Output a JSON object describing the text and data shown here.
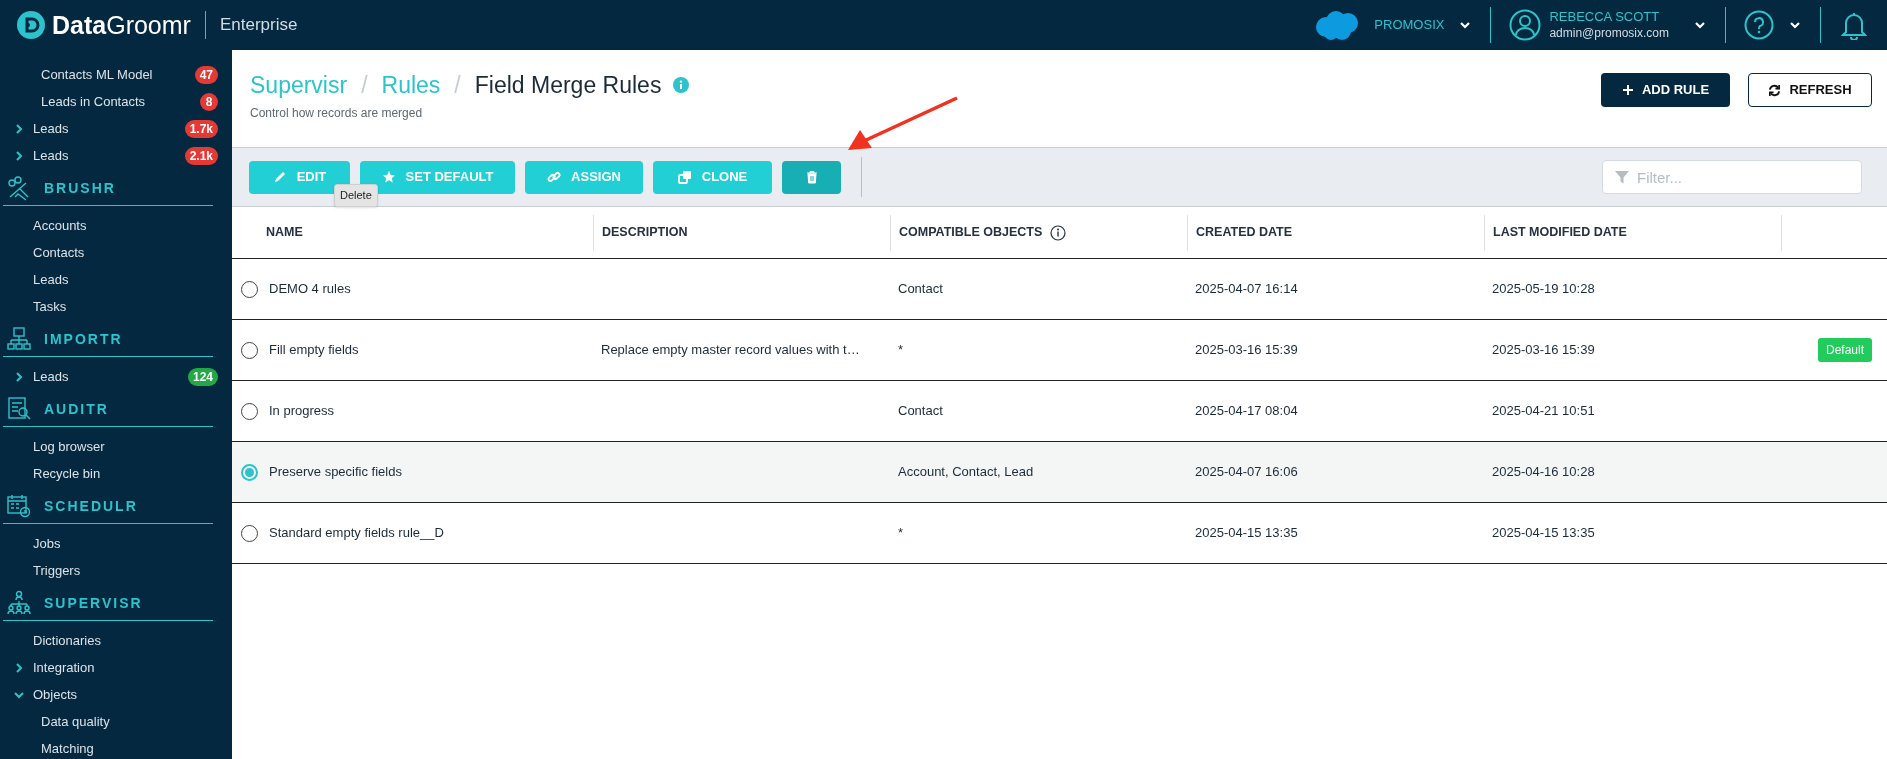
{
  "app": {
    "logo_bold": "Data",
    "logo_light": "Groomr",
    "edition": "Enterprise"
  },
  "org": {
    "name": "PROMOSIX"
  },
  "user": {
    "name": "REBECCA SCOTT",
    "email": "admin@promosix.com"
  },
  "sidebar": {
    "top_items": [
      {
        "label": "Contacts ML Model",
        "badge": "47",
        "color": "#e53935"
      },
      {
        "label": "Leads in Contacts",
        "badge": "8",
        "color": "#e53935"
      }
    ],
    "items": [
      {
        "label": "Leads",
        "expanded": false,
        "badge": "1.7k",
        "color": "#e53935"
      },
      {
        "label": "Leads",
        "expanded": false,
        "badge": "2.1k",
        "color": "#e53935"
      }
    ],
    "sections": [
      {
        "title": "BRUSHR",
        "items": [
          {
            "label": "Accounts"
          },
          {
            "label": "Contacts"
          },
          {
            "label": "Leads"
          },
          {
            "label": "Tasks"
          }
        ]
      },
      {
        "title": "IMPORTR",
        "items": [
          {
            "label": "Leads",
            "expanded": false,
            "badge": "124",
            "color": "#22a845"
          }
        ]
      },
      {
        "title": "AUDITR",
        "items": [
          {
            "label": "Log browser"
          },
          {
            "label": "Recycle bin"
          }
        ]
      },
      {
        "title": "SCHEDULR",
        "items": [
          {
            "label": "Jobs"
          },
          {
            "label": "Triggers"
          }
        ]
      },
      {
        "title": "SUPERVISR",
        "items": [
          {
            "label": "Dictionaries"
          },
          {
            "label": "Integration",
            "expanded": false
          },
          {
            "label": "Objects",
            "expanded": true,
            "children": [
              {
                "label": "Data quality"
              },
              {
                "label": "Matching"
              }
            ]
          }
        ]
      }
    ]
  },
  "breadcrumb": [
    "Supervisr",
    "Rules"
  ],
  "breadcrumb_separator": "/",
  "page_title": "Field Merge Rules",
  "subtitle": "Control how records are merged",
  "header_buttons": [
    {
      "label": "ADD RULE",
      "kind": "primary"
    },
    {
      "label": "REFRESH",
      "kind": "outline"
    }
  ],
  "toolbar": {
    "buttons": [
      {
        "kind": "edit",
        "label": "EDIT",
        "hovered": false
      },
      {
        "kind": "star",
        "label": "SET DEFAULT",
        "hovered": false
      },
      {
        "kind": "link",
        "label": "ASSIGN",
        "hovered": false
      },
      {
        "kind": "clone",
        "label": "CLONE",
        "hovered": false
      },
      {
        "kind": "delete",
        "hovered": true,
        "tooltip": "Delete"
      }
    ],
    "filter": {
      "placeholder": "Filter..."
    }
  },
  "table": {
    "columns": [
      "NAME",
      "DESCRIPTION",
      "COMPATIBLE OBJECTS",
      "CREATED DATE",
      "LAST MODIFIED DATE"
    ],
    "rows": [
      {
        "selected": false,
        "name": "DEMO 4 rules",
        "compatible_objects": "Contact",
        "created": "2025-04-07 16:14",
        "modified": "2025-05-19 10:28"
      },
      {
        "selected": false,
        "name": "Fill empty fields",
        "description": "Replace empty master record values with t…",
        "compatible_objects": "*",
        "created": "2025-03-16 15:39",
        "modified": "2025-03-16 15:39",
        "badge": "Default"
      },
      {
        "selected": false,
        "name": "In progress",
        "compatible_objects": "Contact",
        "created": "2025-04-17 08:04",
        "modified": "2025-04-21 10:51"
      },
      {
        "selected": true,
        "name": "Preserve specific fields",
        "compatible_objects": "Account, Contact, Lead",
        "created": "2025-04-07 16:06",
        "modified": "2025-04-16 10:28"
      },
      {
        "selected": false,
        "name": "Standard empty fields rule__D",
        "compatible_objects": "*",
        "created": "2025-04-15 13:35",
        "modified": "2025-04-15 13:35"
      }
    ]
  }
}
